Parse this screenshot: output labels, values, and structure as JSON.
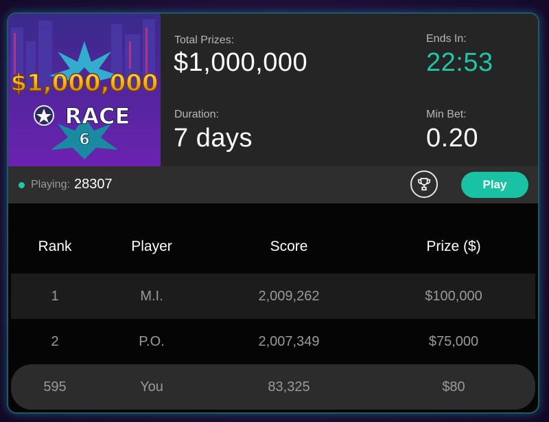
{
  "banner": {
    "amount_text": "$1,000,000",
    "race_text": "RACE",
    "race_number": "6"
  },
  "stats": {
    "total_prizes_label": "Total Prizes:",
    "total_prizes_value": "$1,000,000",
    "ends_in_label": "Ends In:",
    "ends_in_value": "22:53",
    "duration_label": "Duration:",
    "duration_value": "7 days",
    "min_bet_label": "Min Bet:",
    "min_bet_value": "0.20"
  },
  "status": {
    "playing_label": "Playing:",
    "playing_count": "28307",
    "play_button": "Play"
  },
  "leaderboard": {
    "headers": [
      "Rank",
      "Player",
      "Score",
      "Prize ($)"
    ],
    "rows": [
      {
        "rank": "1",
        "player": "M.I.",
        "score": "2,009,262",
        "prize": "$100,000"
      },
      {
        "rank": "2",
        "player": "P.O.",
        "score": "2,007,349",
        "prize": "$75,000"
      },
      {
        "rank": "595",
        "player": "You",
        "score": "83,325",
        "prize": "$80"
      }
    ]
  },
  "colors": {
    "accent": "#19c2a2",
    "ends_in": "#1fc7a6",
    "card_bg": "#050505",
    "header_bg": "#252525"
  }
}
